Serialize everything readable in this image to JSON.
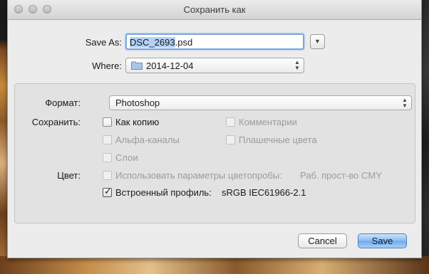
{
  "window": {
    "title": "Сохранить как"
  },
  "file": {
    "save_as_label": "Save As:",
    "filename_selected": "DSC_2693",
    "filename_ext": ".psd",
    "where_label": "Where:",
    "where_value": "2014-12-04"
  },
  "options": {
    "format_label": "Формат:",
    "format_value": "Photoshop",
    "save_label": "Сохранить:",
    "as_copy": "Как копию",
    "comments": "Комментарии",
    "alpha_channels": "Альфа-каналы",
    "spot_colors": "Плашечные цвета",
    "layers": "Слои",
    "color_label": "Цвет:",
    "use_proof": "Использовать параметры цветопробы:",
    "proof_profile": "Раб. прост-во CMY",
    "embedded_profile": "Встроенный профиль:",
    "embedded_profile_value": "sRGB IEC61966-2.1"
  },
  "buttons": {
    "cancel": "Cancel",
    "save": "Save"
  },
  "colors": {
    "accent": "#6ea9ec",
    "focus_ring": "#7aa7e0"
  }
}
